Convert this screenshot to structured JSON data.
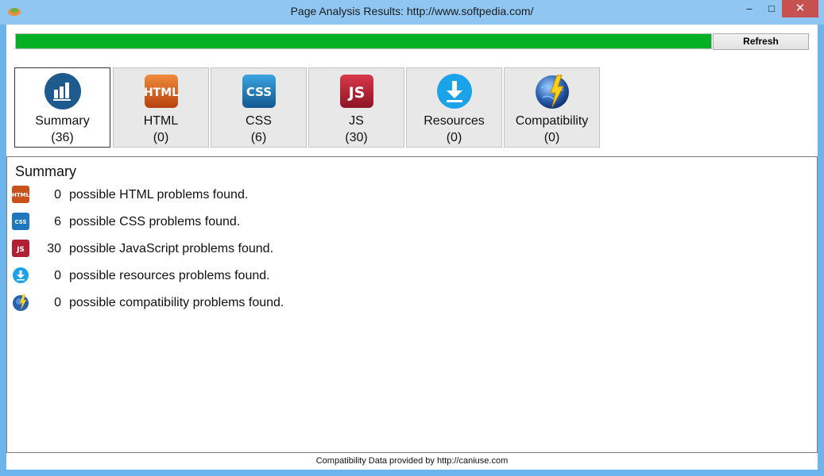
{
  "window": {
    "title": "Page Analysis Results: http://www.softpedia.com/",
    "minimize": "–",
    "maximize": "□",
    "close": "✕"
  },
  "progress": {
    "value_percent": 100,
    "color": "#06b025"
  },
  "toolbar": {
    "refresh_label": "Refresh"
  },
  "tabs": [
    {
      "label": "Summary",
      "count": "(36)",
      "icon": "chart-icon",
      "active": true
    },
    {
      "label": "HTML",
      "count": "(0)",
      "icon": "html-icon",
      "active": false
    },
    {
      "label": "CSS",
      "count": "(6)",
      "icon": "css-icon",
      "active": false
    },
    {
      "label": "JS",
      "count": "(30)",
      "icon": "js-icon",
      "active": false
    },
    {
      "label": "Resources",
      "count": "(0)",
      "icon": "download-icon",
      "active": false
    },
    {
      "label": "Compatibility",
      "count": "(0)",
      "icon": "globe-icon",
      "active": false
    }
  ],
  "summary": {
    "title": "Summary",
    "rows": [
      {
        "icon": "html-icon",
        "count": "0",
        "text": "possible HTML problems found."
      },
      {
        "icon": "css-icon",
        "count": "6",
        "text": "possible CSS problems found."
      },
      {
        "icon": "js-icon",
        "count": "30",
        "text": "possible JavaScript problems found."
      },
      {
        "icon": "download-icon",
        "count": "0",
        "text": "possible resources problems found."
      },
      {
        "icon": "globe-icon",
        "count": "0",
        "text": "possible compatibility problems found."
      }
    ]
  },
  "footer": {
    "text": "Compatibility Data provided by http://caniuse.com"
  },
  "icon_text": {
    "html": "HTML",
    "css": "CSS",
    "js": "JS"
  }
}
